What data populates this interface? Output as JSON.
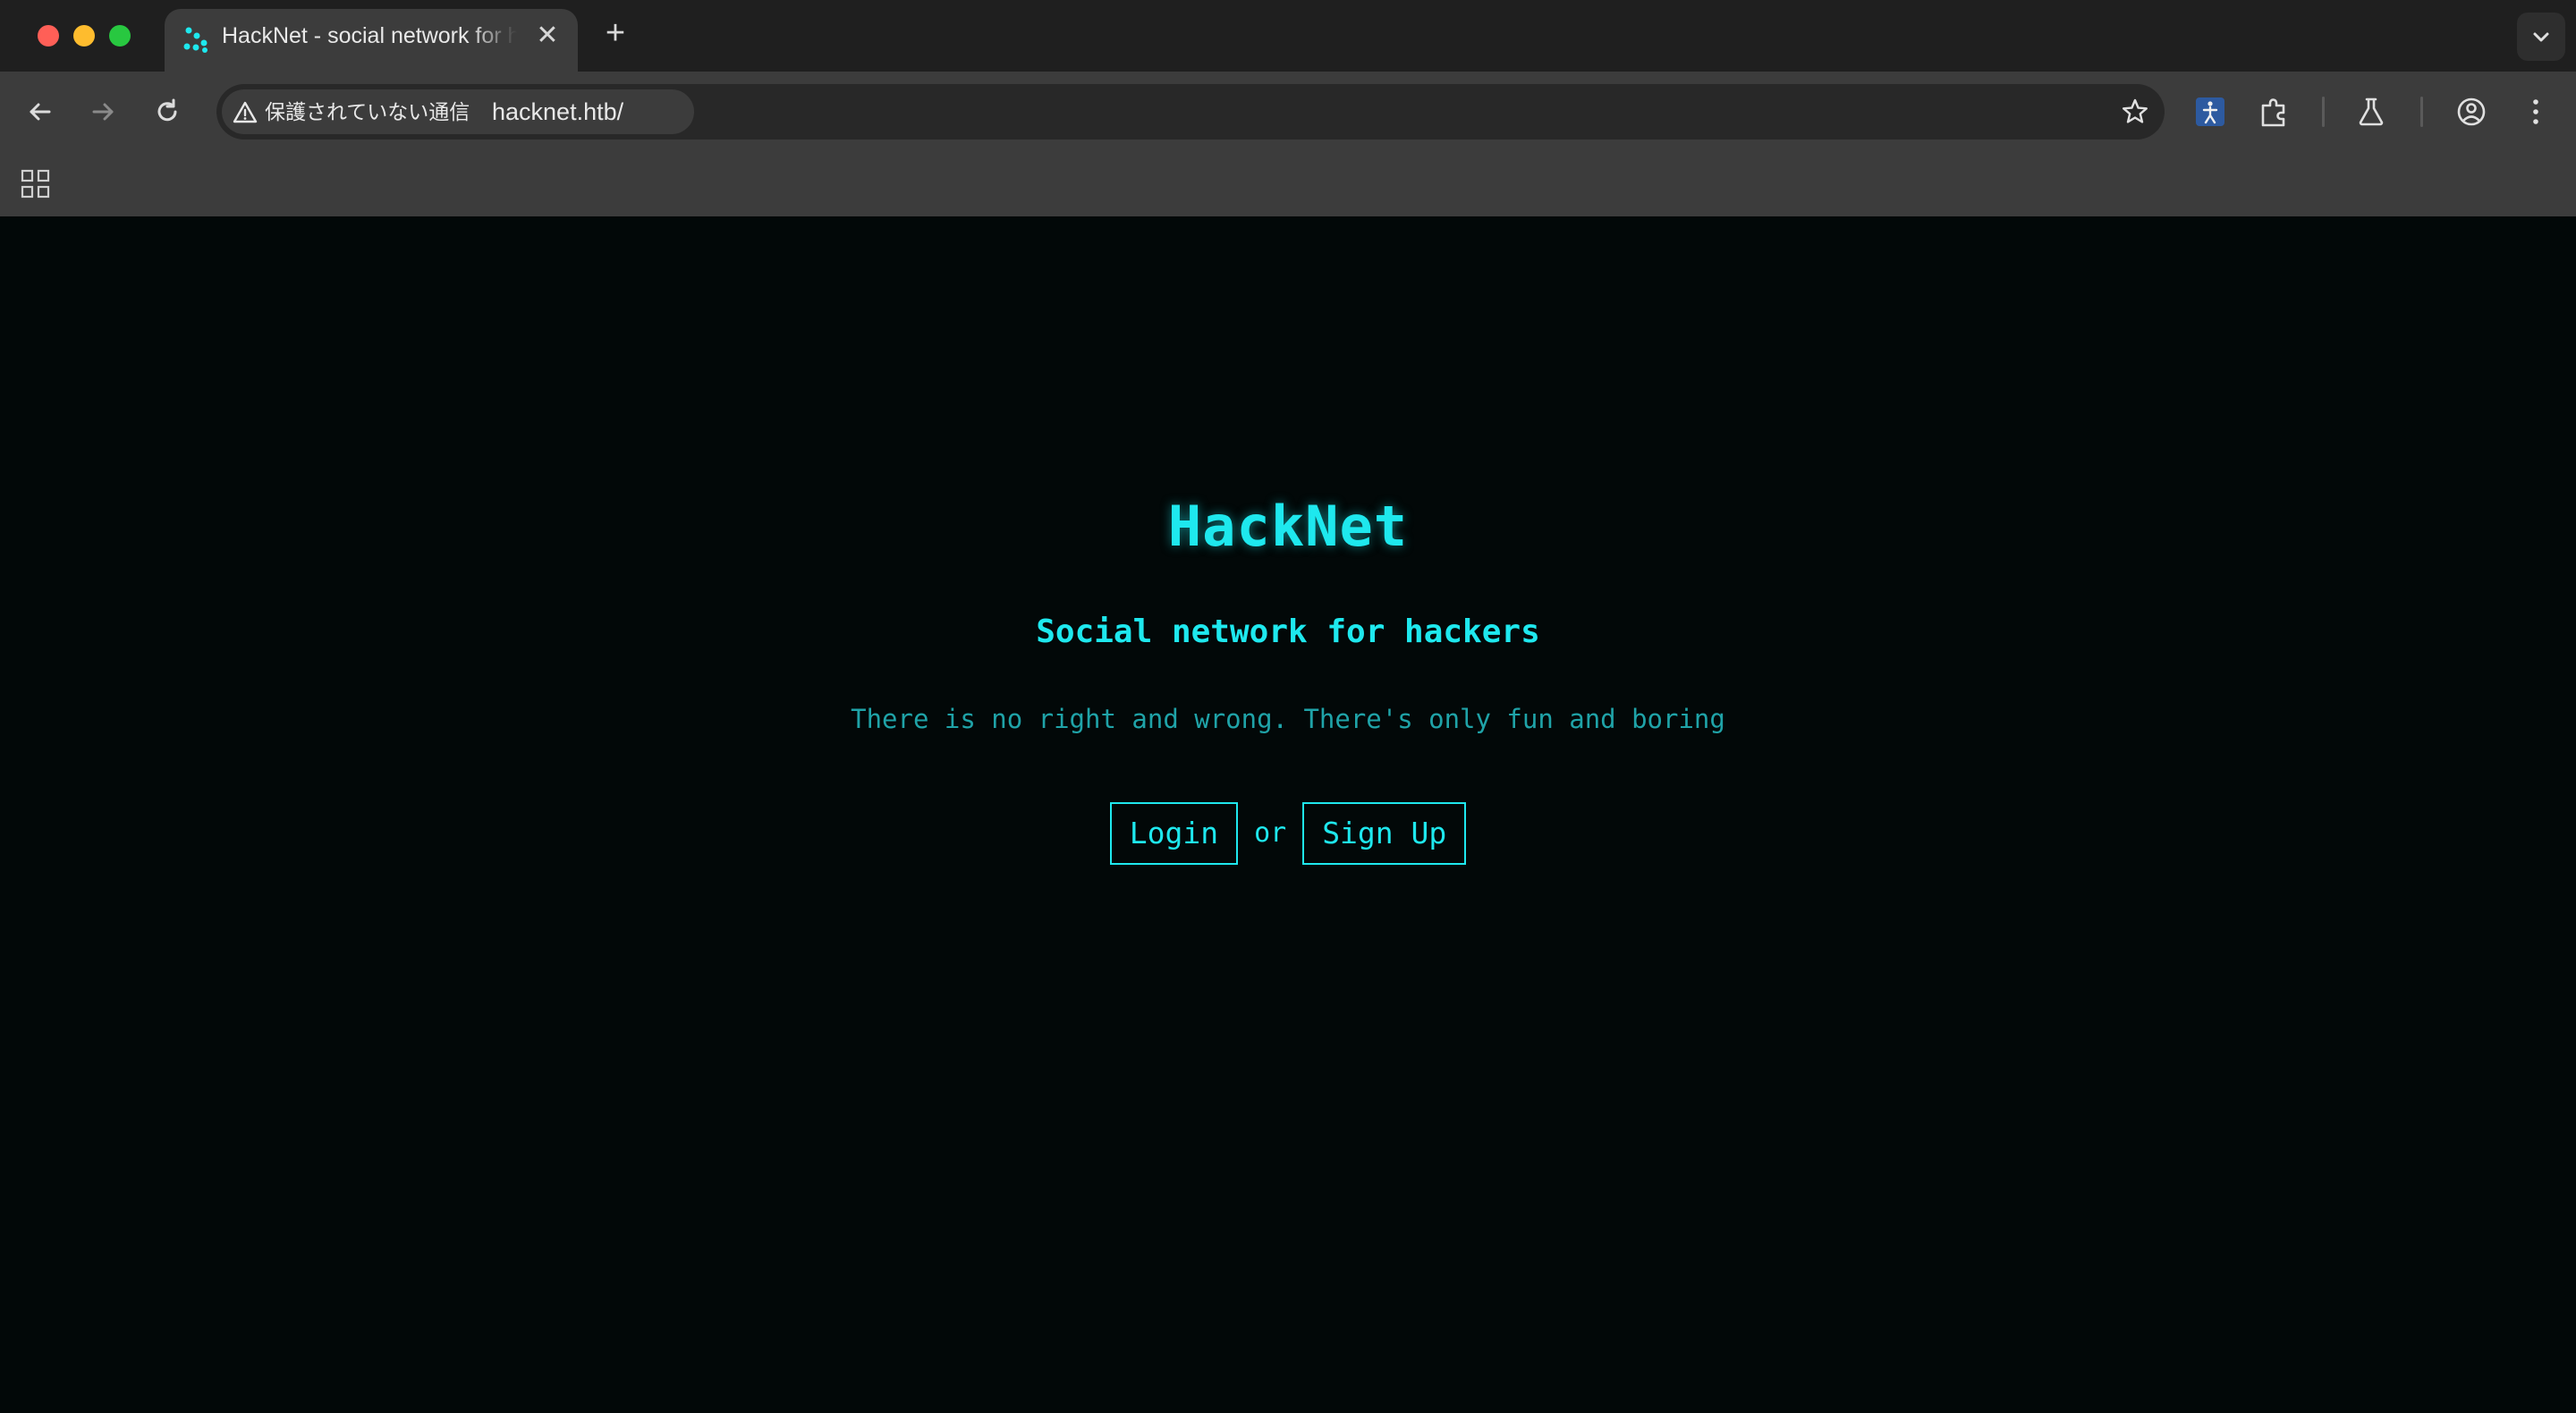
{
  "browser": {
    "tab": {
      "title": "HackNet - social network for hackers",
      "close_glyph": "✕"
    },
    "new_tab_glyph": "+",
    "address_bar": {
      "security_label": "保護されていない通信",
      "url": "hacknet.htb/"
    },
    "icons": [
      "back-icon",
      "forward-icon",
      "reload-icon",
      "warning-icon",
      "star-icon",
      "extension-accessibility-icon",
      "extensions-puzzle-icon",
      "labs-flask-icon",
      "profile-icon",
      "menu-kebab-icon",
      "apps-grid-icon",
      "tab-search-chevron-icon"
    ]
  },
  "page": {
    "title": "HackNet",
    "subtitle": "Social network for hackers",
    "tagline": "There is no right and wrong. There's only fun and boring",
    "login_label": "Login",
    "or_label": "or",
    "signup_label": "Sign Up"
  },
  "colors": {
    "accent": "#1ee8ee",
    "tagline": "#1fa3a8",
    "page_background": "#020808"
  }
}
